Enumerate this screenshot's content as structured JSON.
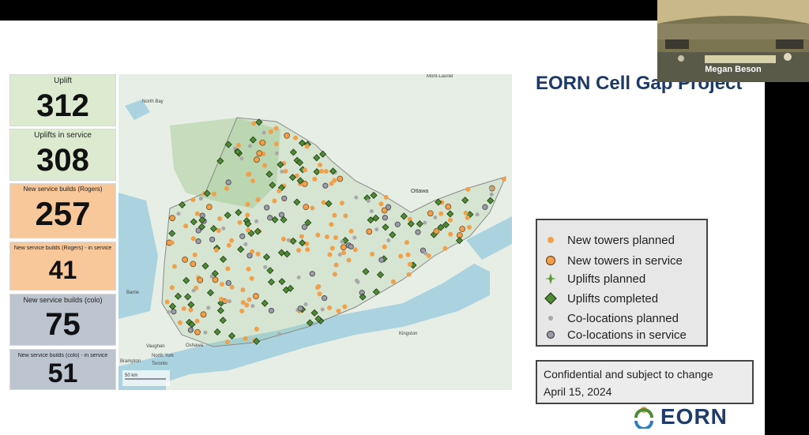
{
  "slide": {
    "title": "EORN Cell Gap Project",
    "stats": [
      {
        "label": "Uplift",
        "value": "312",
        "color": "#dcebcf"
      },
      {
        "label": "Uplifts in service",
        "value": "308",
        "color": "#dcebcf"
      },
      {
        "label": "New service builds (Rogers)",
        "value": "257",
        "color": "#f8c89b"
      },
      {
        "label": "New service builds (Rogers) - in service",
        "value": "41",
        "color": "#f8c89b"
      },
      {
        "label": "New service builds (colo)",
        "value": "75",
        "color": "#bcc4cf"
      },
      {
        "label": "New service builds (colo) - in service",
        "value": "51",
        "color": "#bcc4cf"
      }
    ],
    "legend": [
      {
        "label": "New towers planned",
        "icon": "orange-dot-icon",
        "color": "#f0a04b"
      },
      {
        "label": "New towers in service",
        "icon": "orange-ringed-dot-icon",
        "color": "#f0a04b"
      },
      {
        "label": "Uplifts planned",
        "icon": "green-sparkle-icon",
        "color": "#5c9a3a"
      },
      {
        "label": "Uplifts completed",
        "icon": "green-diamond-icon",
        "color": "#4f8a34"
      },
      {
        "label": "Co-locations planned",
        "icon": "gray-dot-icon",
        "color": "#a8a8a8"
      },
      {
        "label": "Co-locations in service",
        "icon": "gray-ringed-dot-icon",
        "color": "#9a9aa8"
      }
    ],
    "notice": {
      "line1": "Confidential and subject to change",
      "line2": "April 15, 2024"
    },
    "logo_text": "EORN"
  },
  "map": {
    "place_labels": [
      "Ottawa",
      "Toronto",
      "Oshawa",
      "Vaughan",
      "Brampton",
      "North York",
      "Barrie",
      "Mont-Laurier",
      "North Bay",
      "Kingston"
    ],
    "scale": "50 km"
  },
  "video": {
    "participant_name": "Megan Beson"
  }
}
